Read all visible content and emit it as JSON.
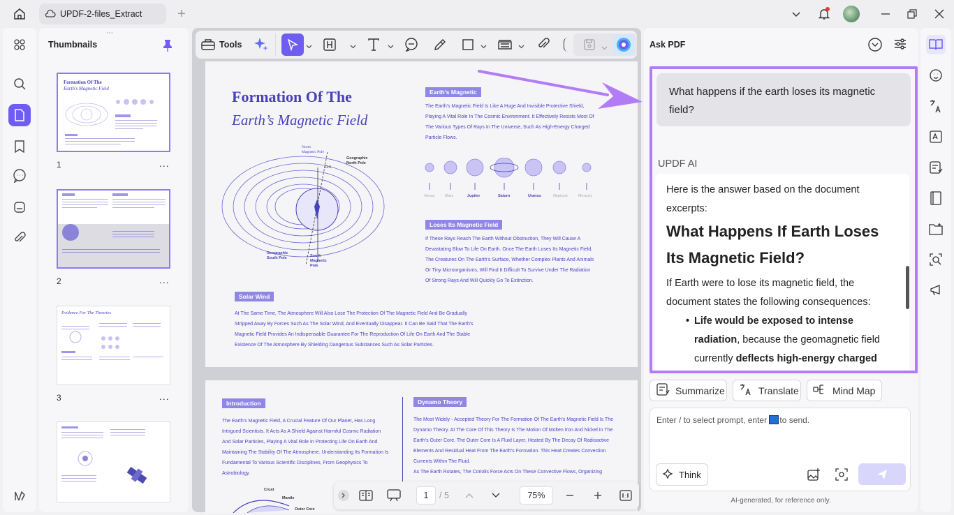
{
  "titlebar": {
    "tab_title": "UPDF-2-files_Extract"
  },
  "thumbnails": {
    "title": "Thumbnails",
    "pages": [
      {
        "num": "1",
        "heading1": "Formation Of The",
        "heading2": "Earth's Magnetic Field"
      },
      {
        "num": "2"
      },
      {
        "num": "3",
        "heading1": "Evidence For The Theories"
      },
      {
        "num": "4"
      }
    ],
    "more": "..."
  },
  "toolbar": {
    "tools_label": "Tools"
  },
  "page1": {
    "title1": "Formation Of The",
    "title2": "Earth’s Magnetic Field",
    "north_mag": "North\nMagnetic Pole",
    "geo_north": "Geographic\nNorth Pole",
    "geo_south": "Geographic\nSouth Pole",
    "south_mag": "South\nMagnetic\nPole",
    "angle": "11.5",
    "earth_field_label": "Earth’s Magnetic",
    "earth_field_text": "The Earth's Magnetic Field Is Like A Huge And Invisible Protective Shield, Playing A Vital Role In The Cosmic Environment. It Effectively Resists Most Of The Various Types Of Rays In The Universe, Such As High-Energy Charged Particle Flows.",
    "planets": [
      "Venus",
      "Mars",
      "Jupiter",
      "Saturn",
      "Uranus",
      "Neptune",
      "Mercury"
    ],
    "loses_label": "Loses Its Magnetic Field",
    "loses_text": "If These Rays Reach The Earth Without Obstruction, They Will Cause A Devastating Blow To Life On Earth. Once The Earth Loses Its Magnetic Field, The Creatures On The Earth's Surface, Whether Complex Plants And Animals Or Tiny Microorganisms, Will Find It Difficult To Survive Under The Radiation Of Strong Rays And Will Quickly Go To Extinction.",
    "solar_label": "Solar Wind",
    "solar_text": "At The Same Time, The Atmosphere Will Also Lose The Protection Of The Magnetic Field And Be Gradually Stripped Away By Forces Such As The Solar Wind, And Eventually Disappear. It Can Be Said That The Earth's Magnetic Field Provides An Indispensable Guarantee For The Reproduction Of Life On Earth And The Stable Existence Of The Atmosphere By Shielding Dangerous Substances Such As Solar Particles."
  },
  "page2": {
    "intro_label": "Introduction",
    "intro_text": "The Earth's Magnetic Field, A Crucial Feature Of Our Planet, Has Long Intrigued Scientists. It Acts As A Shield Against Harmful Cosmic Radiation And Solar Particles, Playing A Vital Role In Protecting Life On Earth And Maintaining The Stability Of The Atmosphere. Understanding Its Formation Is Fundamental To Various Scientific Disciplines, From Geophysics To Astrobiology.",
    "dynamo_label": "Dynamo Theory",
    "dynamo_text": "The Most Widely - Accepted Theory For The Formation Of The Earth's Magnetic Field Is The Dynamo Theory. At The Core Of This Theory Is The Motion Of Molten Iron And Nickel In The Earth's Outer Core. The Outer Core Is A Fluid Layer, Heated By The Decay Of Radioactive Elements And Residual Heat From The Earth's Formation. This Heat Creates Convection Currents Within The Fluid.",
    "dynamo_text2": "As The Earth Rotates, The Coriolis Force Acts On These Convective Flows, Organizing",
    "crust": "Crust",
    "mantle": "Mantle",
    "outer_core": "Outer Core"
  },
  "bottom_nav": {
    "page_current": "1",
    "page_total": "/ 5",
    "zoom": "75%"
  },
  "ask_pdf": {
    "title": "Ask PDF",
    "question": "What happens if the earth loses its magnetic field?",
    "ai_name": "UPDF AI",
    "answer_intro": "Here is the answer based on the document excerpts:",
    "answer_heading": "What Happens If Earth Loses Its Magnetic Field?",
    "answer_body": "If Earth were to lose its magnetic field, the document states the following consequences:",
    "bullet_bold1": "Life would be exposed to intense radiation",
    "bullet_rest1": ", because the geomagnetic field currently ",
    "bullet_bold2": "deflects high-energy charged",
    "actions": [
      "Summarize",
      "Translate",
      "Mind Map"
    ],
    "placeholder_pre": "Enter / to select prompt, enter ",
    "placeholder_post": "to send.",
    "think_label": "Think",
    "footnote": "AI-generated, for reference only."
  },
  "colors": {
    "accent": "#6f5cf2",
    "highlight_border": "#b37cf7",
    "doc_heading": "#4842b8"
  }
}
